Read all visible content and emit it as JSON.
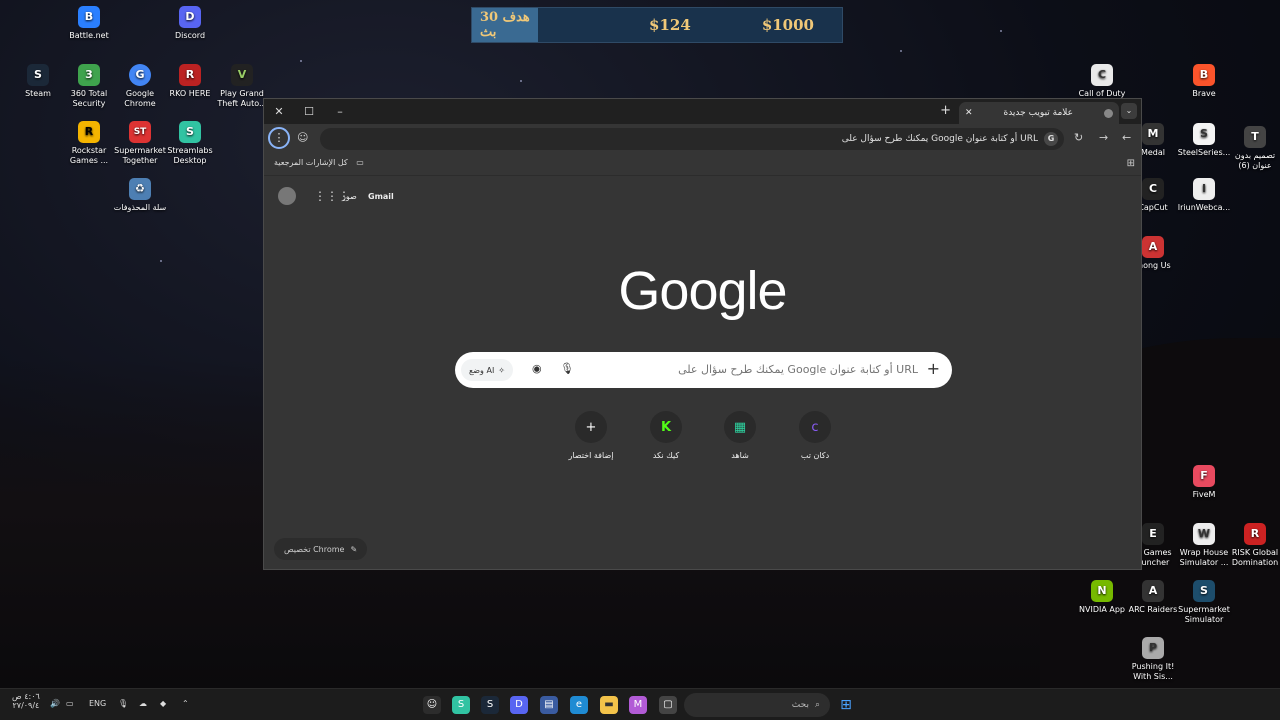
{
  "desktop": {
    "left_icons": [
      {
        "label": "Battle.net",
        "color": "#2a7fff",
        "glyph": "B"
      },
      {
        "label": "Discord",
        "color": "#5865f2",
        "glyph": "D"
      },
      {
        "label": "Steam",
        "color": "#1b2838",
        "glyph": "S"
      },
      {
        "label": "360 Total Security",
        "color": "#3fa34d",
        "glyph": "3"
      },
      {
        "label": "Google Chrome",
        "color": "#4285f4",
        "glyph": "G"
      },
      {
        "label": "RKO HERE",
        "color": "#b22",
        "glyph": "R"
      },
      {
        "label": "Play Grand Theft Auto...",
        "color": "#222",
        "glyph": "V"
      },
      {
        "label": "Rockstar Games ...",
        "color": "#f4b400",
        "glyph": "R"
      },
      {
        "label": "Supermarket Together",
        "color": "#d33",
        "glyph": "ST"
      },
      {
        "label": "Streamlabs Desktop",
        "color": "#31c3a2",
        "glyph": "S"
      },
      {
        "label": "سلة المحذوفات",
        "color": "#4d7fb3",
        "glyph": "♻"
      }
    ],
    "right_icons": [
      {
        "label": "Call of Duty",
        "color": "#e9e9e9",
        "glyph": "C"
      },
      {
        "label": "Brave",
        "color": "#fb542b",
        "glyph": "B"
      },
      {
        "label": "Medal",
        "color": "#333",
        "glyph": "M"
      },
      {
        "label": "SteelSeries...",
        "color": "#f4f4f4",
        "glyph": "S"
      },
      {
        "label": "تصميم بدون عنوان (6)",
        "color": "#444",
        "glyph": "T"
      },
      {
        "label": "CapCut",
        "color": "#222",
        "glyph": "C"
      },
      {
        "label": "IriunWebca...",
        "color": "#eee",
        "glyph": "I"
      },
      {
        "label": "mong Us",
        "color": "#c33",
        "glyph": "A"
      },
      {
        "label": "FiveM",
        "color": "#e84a5f",
        "glyph": "F"
      },
      {
        "label": "ic Games auncher",
        "color": "#222",
        "glyph": "E"
      },
      {
        "label": "Wrap House Simulator ...",
        "color": "#eee",
        "glyph": "W"
      },
      {
        "label": "RISK Global Domination",
        "color": "#c22",
        "glyph": "R"
      },
      {
        "label": "NVIDIA App",
        "color": "#76b900",
        "glyph": "N"
      },
      {
        "label": "ARC Raiders",
        "color": "#333",
        "glyph": "A"
      },
      {
        "label": "Supermarket Simulator",
        "color": "#1d4d6b",
        "glyph": "S"
      },
      {
        "label": "Pushing It! With Sis...",
        "color": "#aaa",
        "glyph": "P"
      }
    ]
  },
  "overlay": {
    "goal": "هدف 30 بث",
    "amount1": "$124",
    "amount2": "$1000"
  },
  "browser": {
    "tab_title": "علامة تبويب جديدة",
    "omnibox_text": "يمكنك طرح سؤال على Google أو كتابة عنوان URL",
    "bookmarks_all": "كل الإشارات المرجعية",
    "gmail": "Gmail",
    "images": "صور",
    "logo": "Google",
    "search_placeholder": "يمكنك طرح سؤال على Google أو كتابة عنوان URL",
    "ai_mode": "وضع AI",
    "shortcuts": [
      {
        "label": "دكان تب",
        "glyph": "c",
        "color": "#8a5cf6"
      },
      {
        "label": "شاهد",
        "glyph": "▦",
        "color": "#2ed3a0"
      },
      {
        "label": "كيك نكد",
        "glyph": "K",
        "color": "#53fc18"
      },
      {
        "label": "إضافة اختصار",
        "glyph": "+",
        "color": "#ffffff"
      }
    ],
    "customize": "تخصيص Chrome"
  },
  "taskbar": {
    "search_placeholder": "بحث",
    "lang": "ENG",
    "time": "٤:٠٦ ص",
    "date": "٢٧/٠٩/٤"
  }
}
